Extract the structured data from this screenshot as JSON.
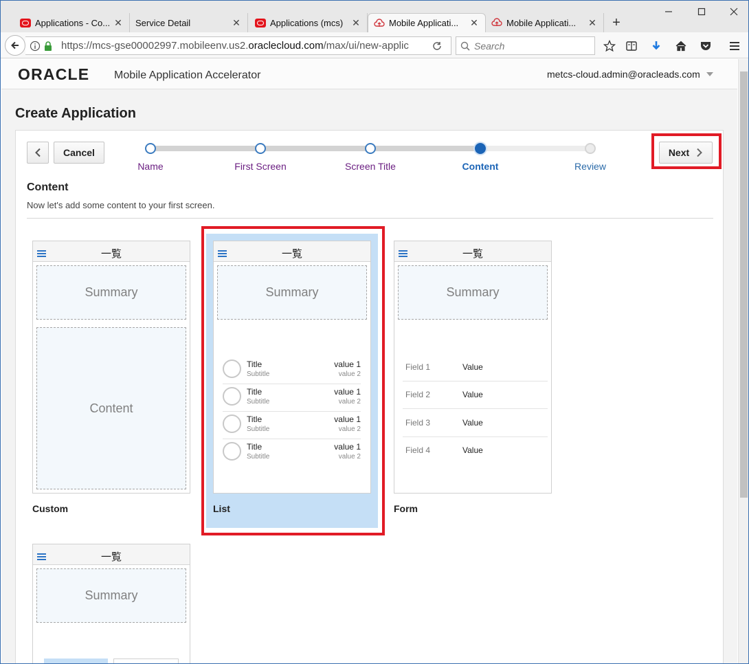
{
  "browser": {
    "tabs": [
      {
        "label": "Applications - Co...",
        "favicon": "oracle-icon"
      },
      {
        "label": "Service Detail",
        "favicon": "none"
      },
      {
        "label": "Applications (mcs)",
        "favicon": "oracle-icon"
      },
      {
        "label": "Mobile Applicati...",
        "favicon": "cloud-icon",
        "active": true
      },
      {
        "label": "Mobile Applicati...",
        "favicon": "cloud-icon"
      }
    ],
    "url_prefix": "https://mcs-gse00002997.mobileenv.us2.",
    "url_domain": "oraclecloud.com",
    "url_suffix": "/max/ui/new-applic",
    "search_placeholder": "Search"
  },
  "header": {
    "logo_text": "ORACLE",
    "app_name": "Mobile Application Accelerator",
    "user_email": "metcs-cloud.admin@oracleads.com"
  },
  "page_title": "Create Application",
  "wizard": {
    "back_label": "<",
    "cancel_label": "Cancel",
    "next_label": "Next",
    "steps": [
      {
        "label": "Name",
        "state": "done"
      },
      {
        "label": "First Screen",
        "state": "done"
      },
      {
        "label": "Screen Title",
        "state": "done"
      },
      {
        "label": "Content",
        "state": "current"
      },
      {
        "label": "Review",
        "state": "future"
      }
    ]
  },
  "section": {
    "title": "Content",
    "description": "Now let's add some content to your first screen."
  },
  "templates": {
    "custom": {
      "header": "一覧",
      "summary": "Summary",
      "content": "Content",
      "label": "Custom"
    },
    "list": {
      "header": "一覧",
      "summary": "Summary",
      "label": "List",
      "rows": [
        {
          "title": "Title",
          "subtitle": "Subtitle",
          "value1": "value 1",
          "value2": "value 2"
        },
        {
          "title": "Title",
          "subtitle": "Subtitle",
          "value1": "value 1",
          "value2": "value 2"
        },
        {
          "title": "Title",
          "subtitle": "Subtitle",
          "value1": "value 1",
          "value2": "value 2"
        },
        {
          "title": "Title",
          "subtitle": "Subtitle",
          "value1": "value 1",
          "value2": "value 2"
        }
      ]
    },
    "form": {
      "header": "一覧",
      "summary": "Summary",
      "label": "Form",
      "fields": [
        {
          "field": "Field 1",
          "value": "Value"
        },
        {
          "field": "Field 2",
          "value": "Value"
        },
        {
          "field": "Field 3",
          "value": "Value"
        },
        {
          "field": "Field 4",
          "value": "Value"
        }
      ]
    },
    "fourth": {
      "header": "一覧",
      "summary": "Summary"
    }
  },
  "colors": {
    "selection_highlight": "#e11b26",
    "selected_card_bg": "#c5dff6",
    "step_done_text": "#6b1f82",
    "step_current": "#1b64b6"
  }
}
